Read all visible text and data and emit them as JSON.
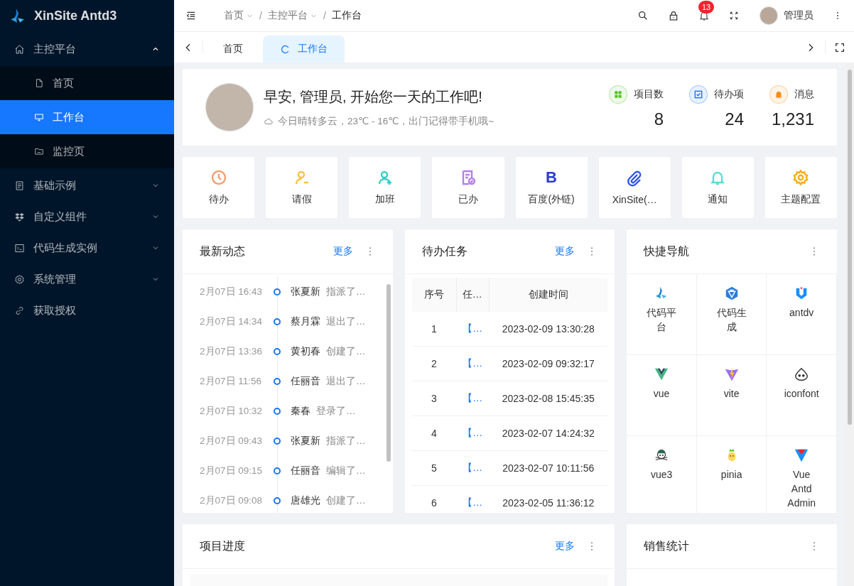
{
  "sidebar": {
    "logo": "XinSite Antd3",
    "menu": [
      {
        "label": "主控平台",
        "expanded": true,
        "children": [
          {
            "label": "首页",
            "selected": false
          },
          {
            "label": "工作台",
            "selected": true
          },
          {
            "label": "监控页",
            "selected": false
          }
        ]
      },
      {
        "label": "基础示例",
        "expanded": false
      },
      {
        "label": "自定义组件",
        "expanded": false
      },
      {
        "label": "代码生成实例",
        "expanded": false
      },
      {
        "label": "系统管理",
        "expanded": false
      },
      {
        "label": "获取授权"
      }
    ]
  },
  "header": {
    "breadcrumb": [
      {
        "label": "首页",
        "dropdown": true
      },
      {
        "separator": "/",
        "label": "主控平台",
        "dropdown": true
      },
      {
        "separator": "/",
        "label": "工作台",
        "dropdown": false
      }
    ],
    "notification_count": "13",
    "user": "管理员"
  },
  "tabs": [
    {
      "label": "首页",
      "selected": false
    },
    {
      "label": "工作台",
      "selected": true
    }
  ],
  "welcome": {
    "greeting": "早安, 管理员, 开始您一天的工作吧!",
    "weather": "今日晴转多云，23℃ - 16℃，出门记得带手机哦~",
    "stats": [
      {
        "label": "项目数",
        "value": "8",
        "color": "#52c41a"
      },
      {
        "label": "待办项",
        "value": "24",
        "color": "#1677ff"
      },
      {
        "label": "消息",
        "value": "1,231",
        "color": "#fa8c16"
      }
    ]
  },
  "shortcuts": [
    {
      "label": "待办",
      "kind": "icon",
      "color": "#f0a070"
    },
    {
      "label": "请假",
      "kind": "icon",
      "color": "#f5c242"
    },
    {
      "label": "加班",
      "kind": "icon",
      "color": "#36cfc9"
    },
    {
      "label": "已办",
      "kind": "icon",
      "color": "#b37feb"
    },
    {
      "label": "百度(外链)",
      "kind": "glyph",
      "glyph": "B",
      "color": "#2f3bd0"
    },
    {
      "label": "XinSite(…",
      "kind": "icon",
      "color": "#2f54eb"
    },
    {
      "label": "通知",
      "kind": "icon",
      "color": "#5cdbd3"
    },
    {
      "label": "主题配置",
      "kind": "icon",
      "color": "#faad14"
    }
  ],
  "activity": {
    "title": "最新动态",
    "more": "更多",
    "items": [
      {
        "time": "2月07日 16:43",
        "name": "张夏新",
        "action": "指派了…"
      },
      {
        "time": "2月07日 14:34",
        "name": "蔡月霖",
        "action": "退出了…"
      },
      {
        "time": "2月07日 13:36",
        "name": "黄初春",
        "action": "创建了…"
      },
      {
        "time": "2月07日 11:56",
        "name": "任丽音",
        "action": "退出了…"
      },
      {
        "time": "2月07日 10:32",
        "name": "秦春",
        "action": "登录了…"
      },
      {
        "time": "2月07日 09:43",
        "name": "张夏新",
        "action": "指派了…"
      },
      {
        "time": "2月07日 09:15",
        "name": "任丽音",
        "action": "编辑了…"
      },
      {
        "time": "2月07日 09:08",
        "name": "唐雄光",
        "action": "创建了…"
      }
    ]
  },
  "todo": {
    "title": "待办任务",
    "more": "更多",
    "columns": [
      "序号",
      "任…",
      "创建时间"
    ],
    "rows": [
      {
        "index": "1",
        "task": "【…",
        "created": "2023-02-09 13:30:28"
      },
      {
        "index": "2",
        "task": "【…",
        "created": "2023-02-09 09:32:17"
      },
      {
        "index": "3",
        "task": "【…",
        "created": "2023-02-08 15:45:35"
      },
      {
        "index": "4",
        "task": "【…",
        "created": "2023-02-07 14:24:32"
      },
      {
        "index": "5",
        "task": "【…",
        "created": "2023-02-07 10:11:56"
      },
      {
        "index": "6",
        "task": "【…",
        "created": "2023-02-05 11:36:12"
      }
    ]
  },
  "quick_nav": {
    "title": "快捷导航",
    "items": [
      {
        "label": "代码平台"
      },
      {
        "label": "代码生成"
      },
      {
        "label": "antdv"
      },
      {
        "label": "vue"
      },
      {
        "label": "vite"
      },
      {
        "label": "iconfont"
      },
      {
        "label": "vue3"
      },
      {
        "label": "pinia"
      },
      {
        "label": "Vue Antd Admin"
      }
    ]
  },
  "progress": {
    "title": "项目进度",
    "more": "更多"
  },
  "sales": {
    "title": "销售统计"
  }
}
